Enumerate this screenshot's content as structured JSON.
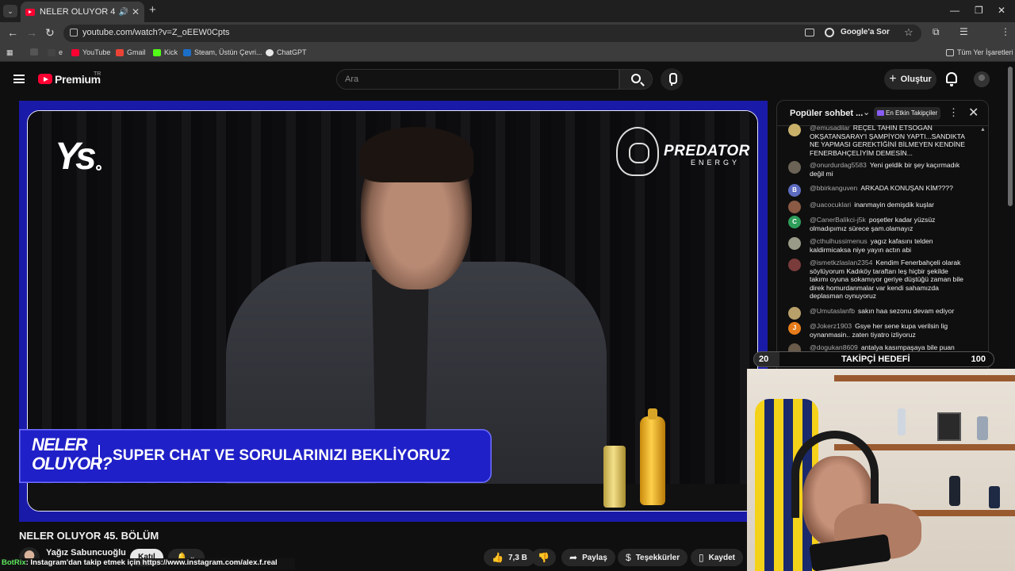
{
  "browser": {
    "tab_title": "NELER OLUYOR 45. BÖLÜM",
    "url": "youtube.com/watch?v=Z_oEEW0Cpts",
    "google_label": "Google'a Sor",
    "bookmarks": [
      "e",
      "YouTube",
      "Gmail",
      "Kick",
      "Steam, Üstün Çevri...",
      "ChatGPT"
    ],
    "all_bookmarks": "Tüm Yer İşaretleri",
    "colors": {
      "youtube": "#ff0033",
      "gmail": "#ea4335",
      "kick": "#53fc18",
      "steam": "#1b6fc9",
      "chatgpt": "#e8e8e8"
    }
  },
  "youtube": {
    "brand": "Premium",
    "region": "TR",
    "search_placeholder": "Ara",
    "create_label": "Oluştur"
  },
  "video": {
    "overlay_logo": "Ys",
    "sponsor_name": "PREDATOR",
    "sponsor_sub": "ENERGY",
    "lower_third_brand": "NELER OLUYOR?",
    "lower_third_text": "SUPER CHAT VE SORULARINIZI BEKLİYORUZ",
    "title": "NELER OLUYOR 45. BÖLÜM",
    "channel_name": "Yağız Sabuncuoğlu",
    "join_label": "Katıl",
    "likes": "7,3 B",
    "share_label": "Paylaş",
    "thanks_label": "Teşekkürler",
    "save_label": "Kaydet"
  },
  "chat": {
    "title": "Popüler sohbet ...",
    "badge": "En Etkin Takipçiler",
    "messages": [
      {
        "user": "@emusadilar",
        "text": "REÇEL TAHIN ETSOGAN OKŞATANSARAY'I ŞAMPİYON YAPTI...SANDIKTA NE YAPMASI GEREKTİĞİNİ BİLMEYEN KENDİNE FENERBAHÇELİYİM DEMESİN...",
        "avatar": "",
        "color": "#c9b16a"
      },
      {
        "user": "@onurdurdag5583",
        "text": "Yeni geldik bir şey kaçırmadık değil mi",
        "avatar": "",
        "color": "#6b6356"
      },
      {
        "user": "@bbirkanguven",
        "text": "ARKADA KONUŞAN KİM????",
        "avatar": "B",
        "color": "#5c6bc0"
      },
      {
        "user": "@uacocuklari",
        "text": "inanmayin demişdik kuşlar",
        "avatar": "",
        "color": "#8a5a44"
      },
      {
        "user": "@CanerBalikci-j5k",
        "text": "poşetler kadar yüzsüz olmadıpımız sürece şam.olamayız",
        "avatar": "C",
        "color": "#2e9e5b"
      },
      {
        "user": "@cthulhussimenus",
        "text": "yagız kafasını telden kaldirmicaksa niye yayın actın abi",
        "avatar": "",
        "color": "#9a9a88"
      },
      {
        "user": "@ismetkzlaslan2354",
        "text": "Kendim Fenerbahçeli olarak söylüyorum Kadıköy taraftarı leş hiçbir şekilde takımı oyuna sokamıyor geriye düştüğü zaman bile direk homurdanmalar var kendi sahamızda deplasman oynuyoruz",
        "avatar": "",
        "color": "#7a3b3b"
      },
      {
        "user": "@Umutaslanfb",
        "text": "sakın haa sezonu devam ediyor",
        "avatar": "",
        "color": "#b8a06a"
      },
      {
        "user": "@Jokerz1903",
        "text": "Gsye her sene kupa verilsin lig oynanmasin.. zaten tiyatro izliyoruz",
        "avatar": "J",
        "color": "#e67c1a"
      },
      {
        "user": "@dogukan8609",
        "text": "antalya kasımpaşaya bile puan veren takım",
        "avatar": "",
        "color": "#6a5a4a"
      }
    ]
  },
  "stream_overlay": {
    "goal_label": "TAKİPÇİ HEDEFİ",
    "goal_min": "20",
    "goal_max": "100",
    "bot_name": "BotRix",
    "bot_message": ": Instagram'dan takip etmek için https://www.instagram.com/alex.f.real"
  }
}
